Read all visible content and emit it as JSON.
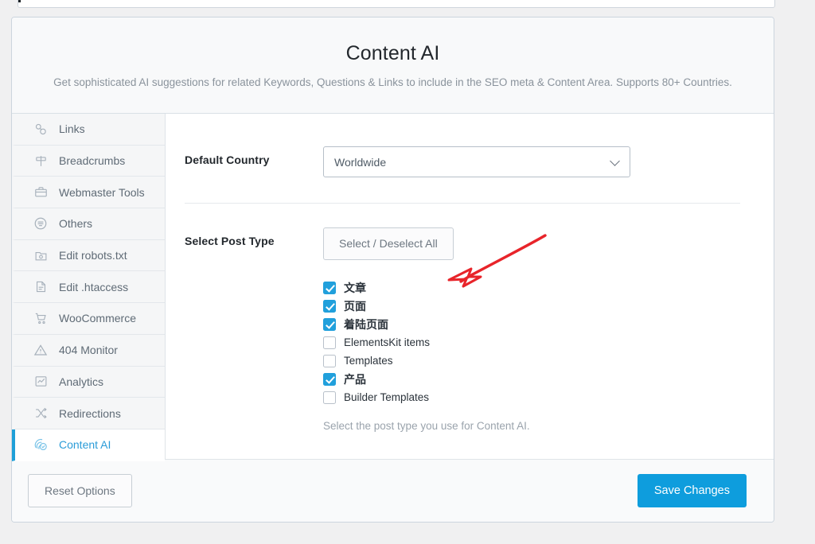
{
  "header": {
    "title": "Content AI",
    "subtitle": "Get sophisticated AI suggestions for related Keywords, Questions & Links to include in the SEO meta & Content Area. Supports 80+ Countries."
  },
  "sidebar": {
    "items": [
      {
        "label": "Links",
        "icon": "links-icon",
        "active": false
      },
      {
        "label": "Breadcrumbs",
        "icon": "signpost-icon",
        "active": false
      },
      {
        "label": "Webmaster Tools",
        "icon": "toolbox-icon",
        "active": false
      },
      {
        "label": "Others",
        "icon": "list-circle-icon",
        "active": false
      },
      {
        "label": "Edit robots.txt",
        "icon": "robots-file-icon",
        "active": false
      },
      {
        "label": "Edit .htaccess",
        "icon": "document-icon",
        "active": false
      },
      {
        "label": "WooCommerce",
        "icon": "shopping-cart-icon",
        "active": false
      },
      {
        "label": "404 Monitor",
        "icon": "warning-triangle-icon",
        "active": false
      },
      {
        "label": "Analytics",
        "icon": "chart-line-icon",
        "active": false
      },
      {
        "label": "Redirections",
        "icon": "shuffle-arrows-icon",
        "active": false
      },
      {
        "label": "Content AI",
        "icon": "content-ai-icon",
        "active": true
      }
    ]
  },
  "main": {
    "default_country": {
      "label": "Default Country",
      "value": "Worldwide",
      "caret_icon": "chevron-down-icon"
    },
    "post_type": {
      "label": "Select Post Type",
      "select_all_label": "Select / Deselect All",
      "help_text": "Select the post type you use for Content AI.",
      "options": [
        {
          "label": "文章",
          "checked": true,
          "cjk": true
        },
        {
          "label": "页面",
          "checked": true,
          "cjk": true
        },
        {
          "label": "着陆页面",
          "checked": true,
          "cjk": true
        },
        {
          "label": "ElementsKit items",
          "checked": false,
          "cjk": false
        },
        {
          "label": "Templates",
          "checked": false,
          "cjk": false
        },
        {
          "label": "产品",
          "checked": true,
          "cjk": true
        },
        {
          "label": "Builder Templates",
          "checked": false,
          "cjk": false
        }
      ]
    }
  },
  "footer": {
    "reset_label": "Reset Options",
    "save_label": "Save Changes"
  },
  "annotation": {
    "arrow": "red-arrow-annotation",
    "color": "#e8242a"
  },
  "colors": {
    "accent": "#0e9ddd",
    "checkbox_on": "#21a0dc",
    "page_bg": "#f0f0f1",
    "annotation_red": "#e8242a"
  }
}
